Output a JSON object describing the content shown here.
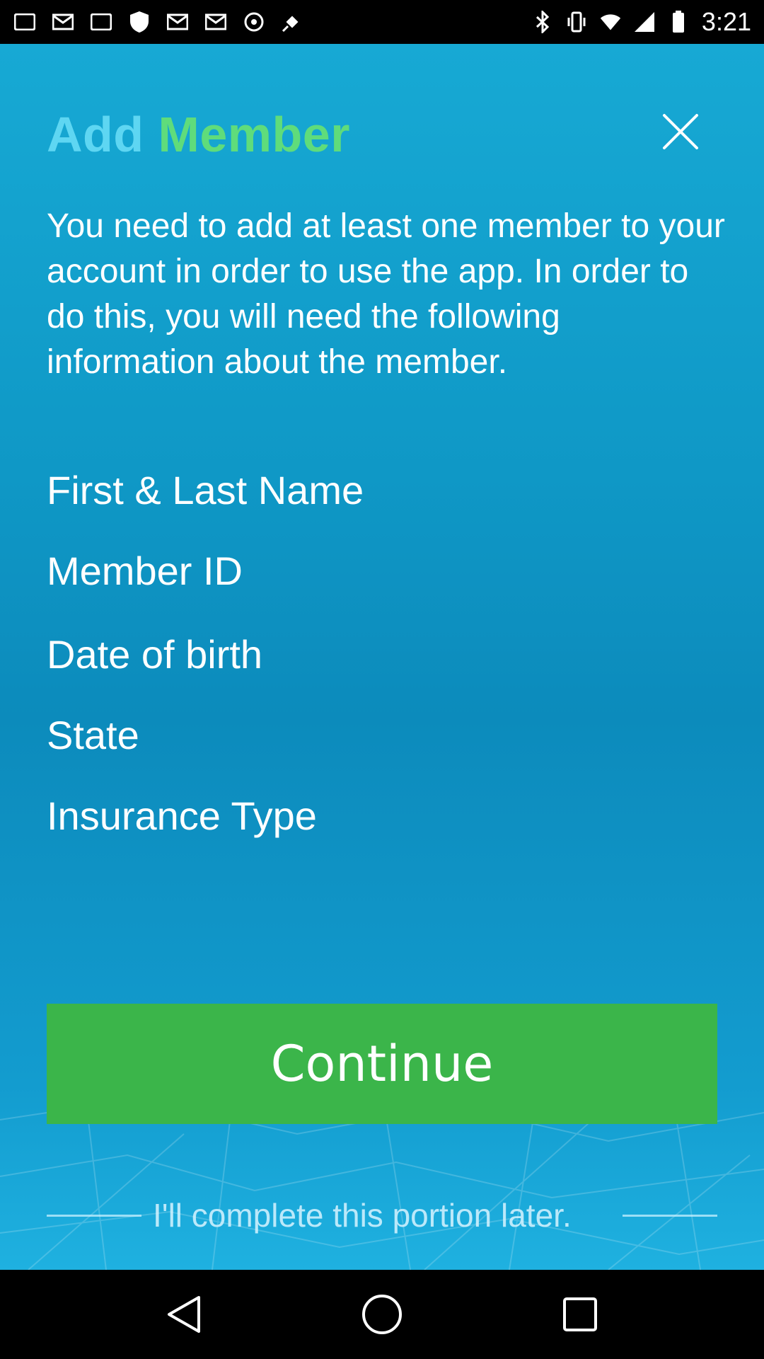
{
  "status_bar": {
    "time": "3:21",
    "icons": [
      "notification-icon",
      "mail-icon",
      "notification-icon",
      "shield-icon",
      "mail-icon",
      "mail-icon",
      "cloud-icon",
      "satellite-icon",
      "bluetooth-icon",
      "vibrate-icon",
      "wifi-icon",
      "signal-icon",
      "battery-icon"
    ]
  },
  "header": {
    "title_part1": "Add",
    "title_part2": "Member",
    "close_icon": "close-icon"
  },
  "intro_text": "You need to add at least one member to your account in order to use the app. In order to do this, you will need the following information about the member.",
  "requirements": [
    "First & Last Name",
    "Member ID",
    "Date of birth",
    "State",
    "Insurance Type"
  ],
  "continue_label": "Continue",
  "later_label": "I'll complete this portion later.",
  "colors": {
    "title_add": "#5ed6f2",
    "title_member": "#5fdc7b",
    "button_green": "#3bb54a",
    "background_blue": "#0f98c6"
  },
  "nav": [
    "back-icon",
    "home-icon",
    "recents-icon"
  ]
}
